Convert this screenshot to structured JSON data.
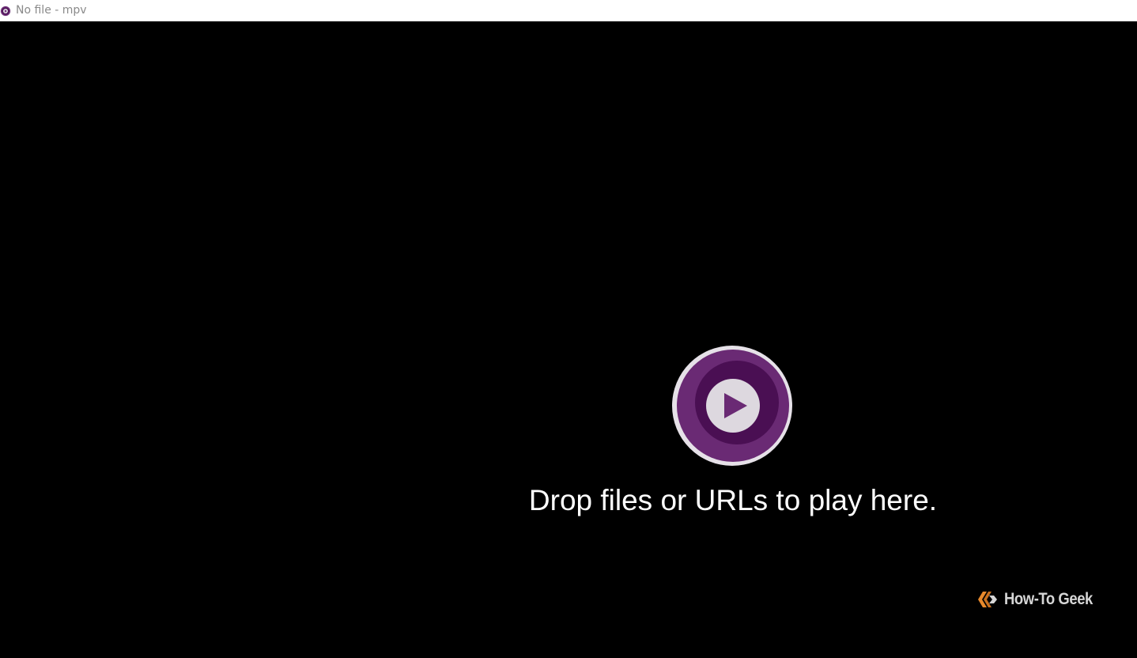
{
  "window": {
    "title": "No file - mpv",
    "app_icon": "mpv-icon"
  },
  "player": {
    "logo_icon": "mpv-play-logo-icon",
    "message": "Drop files or URLs to play here."
  },
  "watermark": {
    "icon": "how-to-geek-logo-icon",
    "text": "How-To Geek"
  },
  "colors": {
    "titlebar_bg": "#ffffff",
    "title_text": "#8a8a8a",
    "video_bg": "#000000",
    "logo_outer_ring": "#e6e1e8",
    "logo_outer": "#6a2a74",
    "logo_mid": "#4a0f53",
    "logo_play_circle": "#ddd8df",
    "logo_play_triangle": "#6a2a74",
    "message_text": "#ffffff",
    "watermark_accent": "#e8892b",
    "watermark_text": "#d6d6d6"
  }
}
